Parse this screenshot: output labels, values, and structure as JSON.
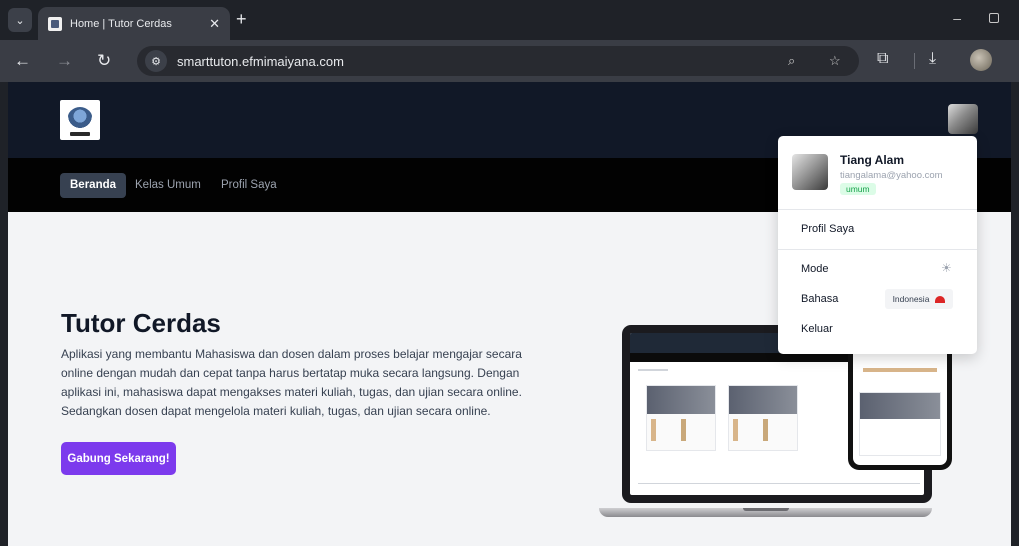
{
  "browser": {
    "tab_title": "Home | Tutor Cerdas",
    "url": "smarttuton.efmimaiyana.com"
  },
  "site": {
    "nav": [
      {
        "label": "Beranda",
        "active": true
      },
      {
        "label": "Kelas Umum",
        "active": false
      },
      {
        "label": "Profil Saya",
        "active": false
      }
    ],
    "hero": {
      "title": "Tutor Cerdas",
      "description": "Aplikasi yang membantu Mahasiswa dan dosen dalam proses belajar mengajar secara online dengan mudah dan cepat tanpa harus bertatap muka secara langsung. Dengan aplikasi ini, mahasiswa dapat mengakses materi kuliah, tugas, dan ujian secara online. Sedangkan dosen dapat mengelola materi kuliah, tugas, dan ujian secara online.",
      "cta_label": "Gabung Sekarang!"
    },
    "accent_color": "#7c3aed",
    "header_color": "#111827",
    "nav_color": "#020202"
  },
  "dropdown": {
    "user_name": "Tiang Alam",
    "user_email": "tiangalama@yahoo.com",
    "role_badge": "umum",
    "profile_label": "Profil Saya",
    "mode_label": "Mode",
    "mode_icon": "sun-icon",
    "language_label": "Bahasa",
    "language_value": "Indonesia",
    "logout_label": "Keluar"
  }
}
